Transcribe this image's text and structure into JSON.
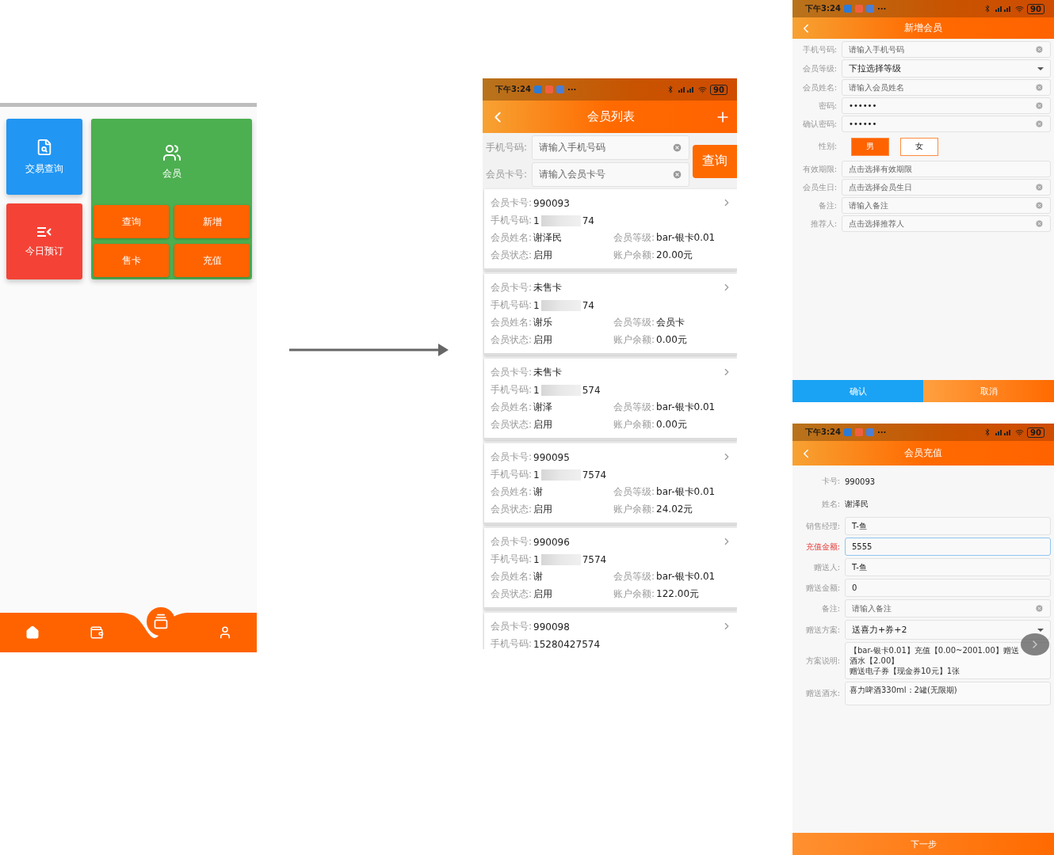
{
  "home": {
    "tiles": [
      {
        "label": "交易查询",
        "kind": "search",
        "color": "#2196f3"
      },
      {
        "label": "今日预订",
        "kind": "list",
        "color": "#f44336"
      }
    ],
    "member_tile": {
      "label": "会员",
      "actions": [
        "查询",
        "新增",
        "售卡",
        "充值"
      ]
    },
    "nav": [
      {
        "kind": "home"
      },
      {
        "kind": "wallet"
      },
      {
        "kind": "add"
      },
      {
        "kind": "user"
      }
    ]
  },
  "member_list": {
    "status_bar": {
      "time": "下午3:24",
      "more": "···",
      "battery": "90"
    },
    "title": "会员列表",
    "search": [
      {
        "label": "手机号码:",
        "placeholder": "请输入手机号码"
      },
      {
        "label": "会员卡号:",
        "placeholder": "请输入会员卡号"
      }
    ],
    "search_button": "查询",
    "members": [
      {
        "blurred": true,
        "rows": [
          [
            {
              "label": "会员卡号:",
              "value": "990093"
            }
          ],
          [
            {
              "label": "手机号码:",
              "value": "1",
              "value_end": "74"
            }
          ],
          [
            {
              "label": "会员姓名:",
              "value": "谢泽民"
            },
            {
              "label": "会员等级:",
              "value": "bar-银卡0.01"
            }
          ],
          [
            {
              "label": "会员状态:",
              "value": "启用"
            },
            {
              "label": "账户余额:",
              "value": "20.00元"
            }
          ]
        ]
      },
      {
        "blurred": true,
        "rows": [
          [
            {
              "label": "会员卡号:",
              "value": "未售卡"
            }
          ],
          [
            {
              "label": "手机号码:",
              "value": "1",
              "value_end": "74"
            }
          ],
          [
            {
              "label": "会员姓名:",
              "value": "谢乐"
            },
            {
              "label": "会员等级:",
              "value": "会员卡"
            }
          ],
          [
            {
              "label": "会员状态:",
              "value": "启用"
            },
            {
              "label": "账户余额:",
              "value": "0.00元"
            }
          ]
        ]
      },
      {
        "blurred": true,
        "rows": [
          [
            {
              "label": "会员卡号:",
              "value": "未售卡"
            }
          ],
          [
            {
              "label": "手机号码:",
              "value": "1",
              "value_end": "574"
            }
          ],
          [
            {
              "label": "会员姓名:",
              "value": "谢泽"
            },
            {
              "label": "会员等级:",
              "value": "bar-银卡0.01"
            }
          ],
          [
            {
              "label": "会员状态:",
              "value": "启用"
            },
            {
              "label": "账户余额:",
              "value": "0.00元"
            }
          ]
        ]
      },
      {
        "blurred": true,
        "rows": [
          [
            {
              "label": "会员卡号:",
              "value": "990095"
            }
          ],
          [
            {
              "label": "手机号码:",
              "value": "1",
              "value_end": "7574"
            }
          ],
          [
            {
              "label": "会员姓名:",
              "value": "谢"
            },
            {
              "label": "会员等级:",
              "value": "bar-银卡0.01"
            }
          ],
          [
            {
              "label": "会员状态:",
              "value": "启用"
            },
            {
              "label": "账户余额:",
              "value": "24.02元"
            }
          ]
        ]
      },
      {
        "blurred": true,
        "rows": [
          [
            {
              "label": "会员卡号:",
              "value": "990096"
            }
          ],
          [
            {
              "label": "手机号码:",
              "value": "1",
              "value_end": "7574"
            }
          ],
          [
            {
              "label": "会员姓名:",
              "value": "谢"
            },
            {
              "label": "会员等级:",
              "value": "bar-银卡0.01"
            }
          ],
          [
            {
              "label": "会员状态:",
              "value": "启用"
            },
            {
              "label": "账户余额:",
              "value": "122.00元"
            }
          ]
        ]
      },
      {
        "blurred": false,
        "rows": [
          [
            {
              "label": "会员卡号:",
              "value": "990098"
            }
          ],
          [
            {
              "label": "手机号码:",
              "value": "15280427574"
            }
          ]
        ]
      }
    ]
  },
  "add_member": {
    "status_bar": {
      "time": "下午3:24",
      "more": "···",
      "battery": "90"
    },
    "title": "新增会员",
    "fields": [
      {
        "kind": "input",
        "label": "手机号码:",
        "placeholder": "请输入手机号码",
        "clear": true
      },
      {
        "kind": "select",
        "label": "会员等级:",
        "value": "下拉选择等级"
      },
      {
        "kind": "input",
        "label": "会员姓名:",
        "placeholder": "请输入会员姓名",
        "clear": true
      },
      {
        "kind": "password",
        "label": "密码:",
        "value": "••••••",
        "clear": true
      },
      {
        "kind": "password",
        "label": "确认密码:",
        "value": "••••••",
        "clear": true
      },
      {
        "kind": "choice",
        "label": "性别:",
        "options": [
          {
            "label": "男",
            "selected": true
          },
          {
            "label": "女",
            "selected": false
          }
        ]
      },
      {
        "kind": "input",
        "label": "有效期限:",
        "placeholder": "点击选择有效期限",
        "clear": false
      },
      {
        "kind": "input",
        "label": "会员生日:",
        "placeholder": "点击选择会员生日",
        "clear": true
      },
      {
        "kind": "input",
        "label": "备注:",
        "placeholder": "请输入备注",
        "clear": true
      },
      {
        "kind": "input",
        "label": "推荐人:",
        "placeholder": "点击选择推荐人",
        "clear": true
      }
    ],
    "buttons": [
      "确认",
      "取消"
    ]
  },
  "recharge": {
    "status_bar": {
      "time": "下午3:24",
      "more": "···",
      "battery": "90"
    },
    "title": "会员充值",
    "fields": [
      {
        "kind": "static",
        "label": "卡号:",
        "value": "990093"
      },
      {
        "kind": "static",
        "label": "姓名:",
        "value": "谢泽民"
      },
      {
        "kind": "input",
        "label": "销售经理:",
        "value": "T-鱼",
        "focused": false
      },
      {
        "kind": "input",
        "label": "充值金额:",
        "value": "5555",
        "focused": true
      },
      {
        "kind": "input",
        "label": "赠送人:",
        "value": "T-鱼",
        "focused": false
      },
      {
        "kind": "input",
        "label": "赠送金额:",
        "value": "0",
        "focused": false
      },
      {
        "kind": "input",
        "label": "备注:",
        "placeholder": "请输入备注",
        "clear": true,
        "focused": false
      },
      {
        "kind": "select",
        "label": "赠送方案:",
        "value": "送喜力+券+2"
      },
      {
        "kind": "text",
        "label": "方案说明:",
        "lines": [
          "【bar-银卡0.01】充值【0.00~2001.00】赠送",
          "酒水【2.00】",
          "赠送电子券【现金券10元】1张"
        ]
      },
      {
        "kind": "text",
        "label": "赠送酒水:",
        "lines": [
          "喜力啤酒330ml：2罐(无限期)"
        ]
      }
    ],
    "next_button": "下一步"
  }
}
